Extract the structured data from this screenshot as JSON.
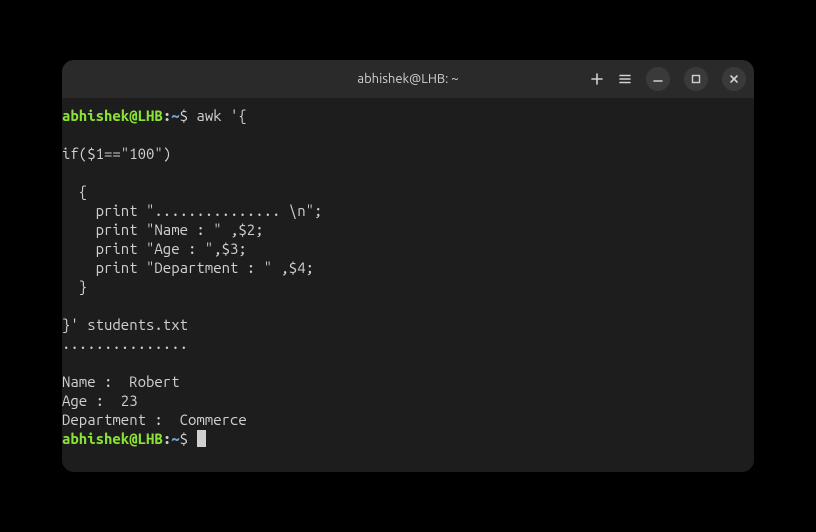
{
  "window": {
    "title": "abhishek@LHB: ~"
  },
  "prompt": {
    "user_host": "abhishek@LHB",
    "colon": ":",
    "path": "~",
    "dollar": "$"
  },
  "command": {
    "line0": " awk '{",
    "line1": "",
    "line2": "if($1==\"100\")",
    "line3": "",
    "line4": "  {",
    "line5": "    print \"............... \\n\";",
    "line6": "    print \"Name : \" ,$2;",
    "line7": "    print \"Age : \",$3;",
    "line8": "    print \"Department : \" ,$4;",
    "line9": "  }",
    "line10": "",
    "line11": "}' students.txt"
  },
  "output": {
    "line0": "............... ",
    "line1": "",
    "line2": "Name :  Robert",
    "line3": "Age :  23",
    "line4": "Department :  Commerce"
  }
}
